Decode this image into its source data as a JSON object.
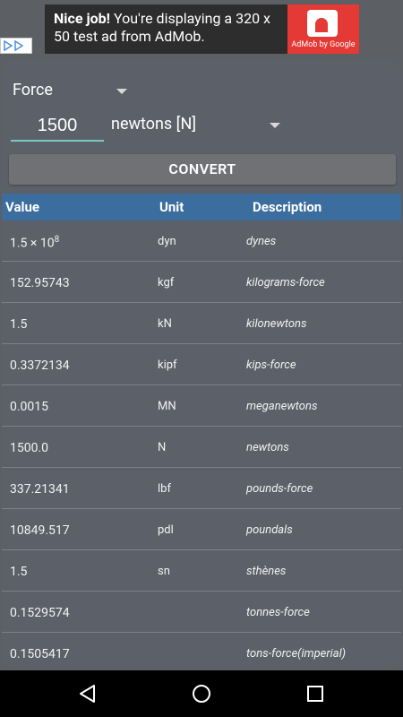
{
  "ad": {
    "headline": "Nice job!",
    "body": " You're displaying a 320 x 50 test ad from AdMob.",
    "brand": "AdMob by Google",
    "brand_color": "#e53935"
  },
  "converter": {
    "category": "Force",
    "input_value": "1500",
    "unit": "newtons [N]",
    "convert_label": "CONVERT"
  },
  "table": {
    "headers": {
      "value": "Value",
      "unit": "Unit",
      "description": "Description"
    },
    "header_color": "#3c6d9f",
    "rows": [
      {
        "value": "1.5 × 10",
        "exp": "8",
        "unit": "dyn",
        "description": "dynes"
      },
      {
        "value": "152.95743",
        "unit": "kgf",
        "description": "kilograms-force"
      },
      {
        "value": "1.5",
        "unit": "kN",
        "description": "kilonewtons"
      },
      {
        "value": "0.3372134",
        "unit": "kipf",
        "description": "kips-force"
      },
      {
        "value": "0.0015",
        "unit": "MN",
        "description": "meganewtons"
      },
      {
        "value": "1500.0",
        "unit": "N",
        "description": "newtons"
      },
      {
        "value": "337.21341",
        "unit": "lbf",
        "description": "pounds-force"
      },
      {
        "value": "10849.517",
        "unit": "pdl",
        "description": "poundals"
      },
      {
        "value": "1.5",
        "unit": "sn",
        "description": "sthènes"
      },
      {
        "value": "0.1529574",
        "unit": "",
        "description": "tonnes-force"
      },
      {
        "value": "0.1505417",
        "unit": "",
        "description": "tons-force(imperial)"
      }
    ]
  },
  "navbar": {
    "icons": [
      "back-icon",
      "home-icon",
      "recents-icon"
    ]
  }
}
